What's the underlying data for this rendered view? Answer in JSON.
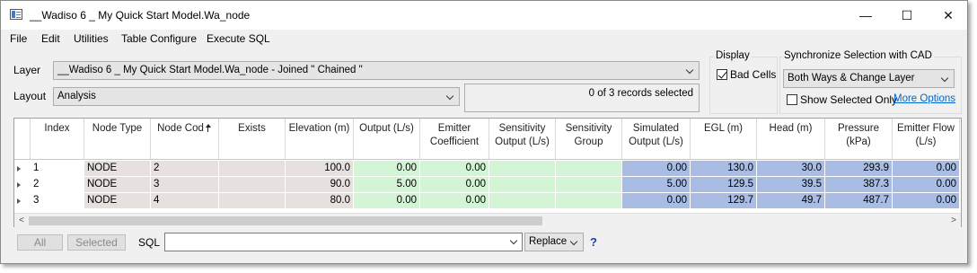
{
  "window": {
    "title": "__Wadiso 6 _ My Quick Start Model.Wa_node",
    "icon": "table-window-icon",
    "controls": {
      "minimize": "—",
      "maximize": "☐",
      "close": "✕"
    }
  },
  "menu": [
    "File",
    "Edit",
    "Utilities",
    "Table Configure",
    "Execute SQL"
  ],
  "layer": {
    "label": "Layer",
    "value": "__Wadiso 6 _ My Quick Start Model.Wa_node - Joined \" Chained \""
  },
  "layout": {
    "label": "Layout",
    "value": "Analysis"
  },
  "status": {
    "records": "0 of 3 records selected"
  },
  "display": {
    "title": "Display",
    "bad_cells_label": "Bad Cells",
    "bad_cells_checked": true
  },
  "sync": {
    "title": "Synchronize Selection with CAD",
    "value": "Both Ways & Change Layer",
    "show_selected_label": "Show Selected Only",
    "show_selected_checked": false,
    "more_options": "More Options"
  },
  "table": {
    "columns": [
      {
        "label": "Index",
        "tone": "grey"
      },
      {
        "label": "Node Type",
        "tone": "grey"
      },
      {
        "label": "Node Cod",
        "tone": "grey",
        "sort": "ascending"
      },
      {
        "label": "Exists",
        "tone": "grey"
      },
      {
        "label": "Elevation (m)",
        "tone": "grey"
      },
      {
        "label": "Output (L/s)",
        "tone": "green"
      },
      {
        "label": "Emitter Coefficient",
        "tone": "green"
      },
      {
        "label": "Sensitivity Output (L/s)",
        "tone": "green"
      },
      {
        "label": "Sensitivity Group",
        "tone": "green"
      },
      {
        "label": "Simulated Output (L/s)",
        "tone": "blue"
      },
      {
        "label": "EGL (m)",
        "tone": "blue"
      },
      {
        "label": "Head (m)",
        "tone": "blue"
      },
      {
        "label": "Pressure (kPa)",
        "tone": "blue"
      },
      {
        "label": "Emitter Flow (L/s)",
        "tone": "blue"
      }
    ],
    "rows": [
      [
        "1",
        "NODE",
        "2",
        "",
        "100.0",
        "0.00",
        "0.00",
        "",
        "",
        "0.00",
        "130.0",
        "30.0",
        "293.9",
        "0.00"
      ],
      [
        "2",
        "NODE",
        "3",
        "",
        "90.0",
        "5.00",
        "0.00",
        "",
        "",
        "5.00",
        "129.5",
        "39.5",
        "387.3",
        "0.00"
      ],
      [
        "3",
        "NODE",
        "4",
        "",
        "80.0",
        "0.00",
        "0.00",
        "",
        "",
        "0.00",
        "129.7",
        "49.7",
        "487.7",
        "0.00"
      ]
    ],
    "scroll_left": "<",
    "scroll_right": ">"
  },
  "footer": {
    "all_label": "All",
    "selected_label": "Selected",
    "sql_label": "SQL",
    "sql_value": "",
    "replace_value": "Replace",
    "help": "?"
  },
  "colors": {
    "grey_cell": "#e6e0df",
    "green_cell": "#d3f5d6",
    "blue_cell": "#a9bde4",
    "link": "#0066cc"
  }
}
